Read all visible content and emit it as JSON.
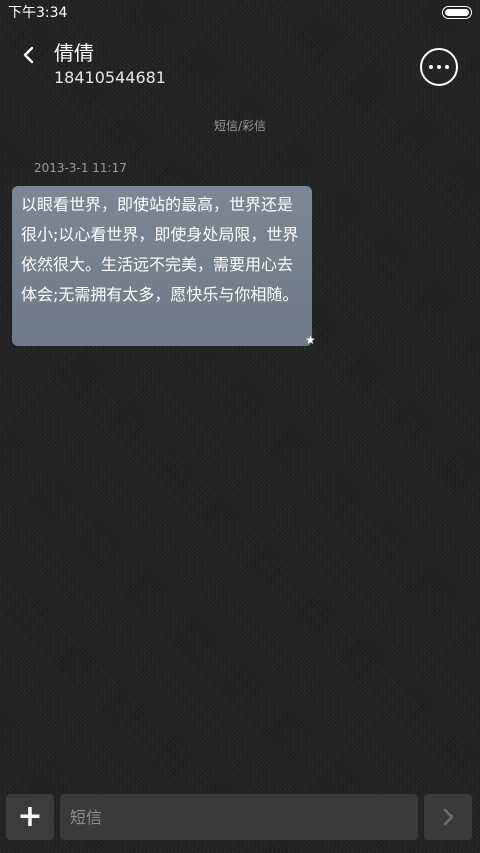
{
  "status_bar": {
    "time": "下午3:34"
  },
  "header": {
    "contact_name": "倩倩",
    "contact_number": "18410544681",
    "back_icon": "chevron-left-icon",
    "more_icon": "more-horizontal-icon"
  },
  "conversation": {
    "type_label": "短信/彩信",
    "messages": [
      {
        "timestamp": "2013-3-1 11:17",
        "text": "以眼看世界，即使站的最高，世界还是很小;以心看世界，即使身处局限，世界依然很大。生活远不完美，需要用心去体会;无需拥有太多，愿快乐与你相随。",
        "starred_mark": "★"
      }
    ]
  },
  "composer": {
    "add_label": "+",
    "input_placeholder": "短信",
    "input_value": "",
    "send_icon": "chevron-right-icon"
  },
  "colors": {
    "background": "#232323",
    "bubble": "#76818f",
    "muted_text": "#9a9a9a"
  }
}
